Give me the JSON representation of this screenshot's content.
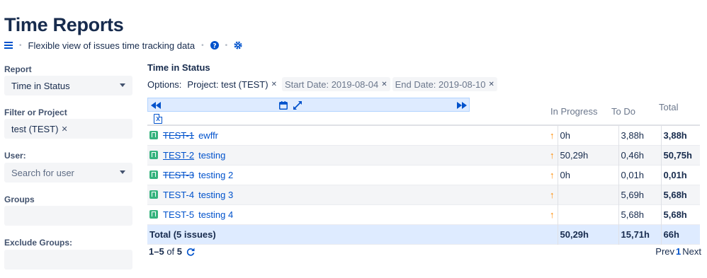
{
  "page": {
    "title": "Time Reports",
    "subtitle": "Flexible view of issues time tracking data"
  },
  "sidebar": {
    "report_label": "Report",
    "report_value": "Time in Status",
    "filter_label": "Filter or Project",
    "filter_tag": "test (TEST)",
    "user_label": "User:",
    "user_placeholder": "Search for user",
    "groups_label": "Groups",
    "exclude_groups_label": "Exclude Groups:"
  },
  "main": {
    "section_title": "Time in Status",
    "options_label": "Options:",
    "options": [
      {
        "label": "Project: test (TEST)"
      },
      {
        "label": "Start Date: 2019-08-04"
      },
      {
        "label": "End Date: 2019-08-10"
      }
    ],
    "excel_label": "X",
    "columns": [
      "In Progress",
      "To Do",
      "Total"
    ],
    "rows": [
      {
        "key": "TEST-1",
        "summary": "ewffr",
        "in_progress": "0h",
        "to_do": "3,88h",
        "total": "3,88h"
      },
      {
        "key": "TEST-2",
        "summary": "testing",
        "in_progress": "50,29h",
        "to_do": "0,46h",
        "total": "50,75h"
      },
      {
        "key": "TEST-3",
        "summary": "testing 2",
        "in_progress": "0h",
        "to_do": "0,01h",
        "total": "0,01h"
      },
      {
        "key": "TEST-4",
        "summary": "testing 3",
        "in_progress": "",
        "to_do": "5,69h",
        "total": "5,68h"
      },
      {
        "key": "TEST-5",
        "summary": "testing 4",
        "in_progress": "",
        "to_do": "5,68h",
        "total": "5,68h"
      }
    ],
    "total_row": {
      "label": "Total (5 issues)",
      "in_progress": "50,29h",
      "to_do": "15,71h",
      "total": "66h"
    },
    "pagination": {
      "range": "1–5",
      "of": "of",
      "count": "5",
      "prev": "Prev",
      "current": "1",
      "next": "Next"
    }
  },
  "icons": {
    "menu": "hamburger-icon",
    "help": "question-circle-icon",
    "settings": "gear-icon",
    "priority": "arrow-up-icon",
    "issue_type": "story-icon",
    "refresh": "refresh-icon"
  },
  "colors": {
    "link": "#0052cc",
    "priority": "#ff8b00",
    "story": "#36b37e",
    "highlight": "#deebff"
  }
}
